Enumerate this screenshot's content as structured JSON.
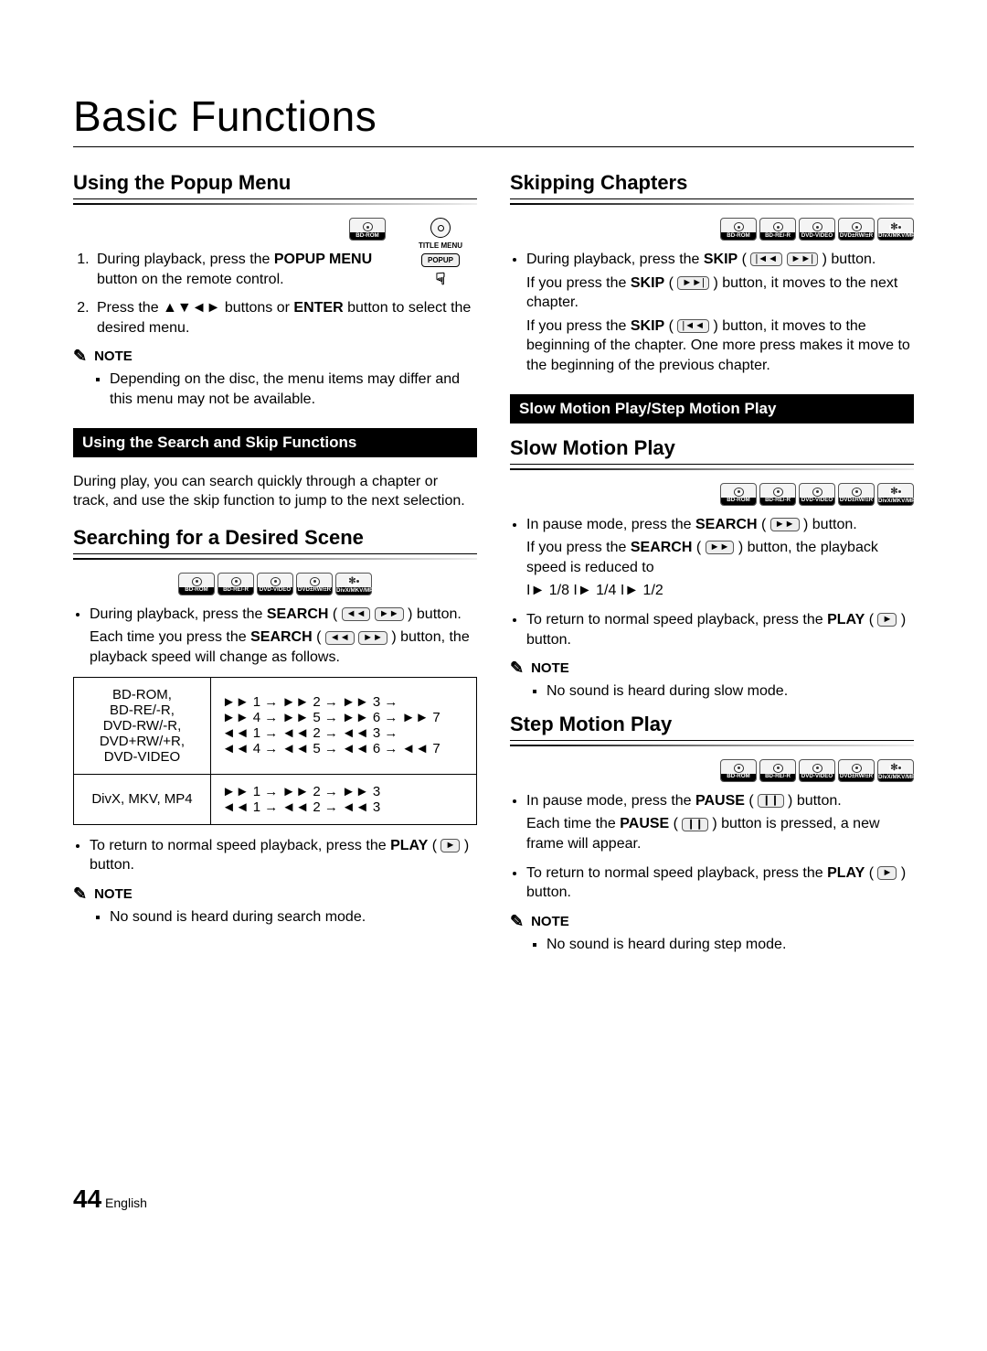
{
  "page_title": "Basic Functions",
  "left": {
    "h_popup": "Using the Popup Menu",
    "remote": {
      "top_label": "TITLE MENU",
      "btn_label": "POPUP"
    },
    "step1_a": "During playback, press the ",
    "step1_b": "POPUP MENU",
    "step1_c": " button on the remote control.",
    "step2_a": "Press the ▲▼◄► buttons or ",
    "step2_b": "ENTER",
    "step2_c": " button to select the desired menu.",
    "note_label": "NOTE",
    "note1": "Depending on the disc, the menu items may differ and this menu may not be available.",
    "bar1": "Using the Search and Skip Functions",
    "bar1_desc": "During play, you can search quickly through a chapter or track, and use the skip function to jump to the next selection.",
    "h_search": "Searching for a Desired Scene",
    "media": [
      "BD-ROM",
      "BD-RE/-R",
      "DVD-VIDEO",
      "DVD±RW/±R",
      "DivX/MKV/MP4"
    ],
    "search_bullet_a": "During playback, press the ",
    "search_bullet_b": "SEARCH",
    "search_bullet_c": " button.",
    "search_sub_a": "Each time you press the ",
    "search_sub_b": "SEARCH",
    "search_sub_c": " button, the playback speed will change as follows.",
    "table_r1_c1": "BD-ROM,\nBD-RE/-R,\nDVD-RW/-R,\nDVD+RW/+R,\nDVD-VIDEO",
    "table_r1_c2_l1": "►► 1 → ►► 2 → ►► 3 →",
    "table_r1_c2_l2": "►► 4 → ►► 5 → ►► 6 → ►► 7",
    "table_r1_c2_l3": "◄◄ 1 → ◄◄ 2 → ◄◄ 3 →",
    "table_r1_c2_l4": "◄◄ 4 → ◄◄ 5 → ◄◄ 6 → ◄◄ 7",
    "table_r2_c1": "DivX, MKV, MP4",
    "table_r2_c2_l1": "►► 1 → ►► 2 → ►► 3",
    "table_r2_c2_l2": "◄◄ 1 → ◄◄ 2 → ◄◄ 3",
    "return_a": "To return to normal speed playback, press the ",
    "return_b": "PLAY",
    "return_c": " button.",
    "note2": "No sound is heard during search mode."
  },
  "right": {
    "h_skip": "Skipping Chapters",
    "media": [
      "BD-ROM",
      "BD-RE/-R",
      "DVD-VIDEO",
      "DVD±RW/±R",
      "DivX/MKV/MP4"
    ],
    "skip_a": "During playback, press the ",
    "skip_b": "SKIP",
    "skip_c": " button.",
    "skip2_a": "If you press the ",
    "skip2_b": "SKIP",
    "skip2_c": " button, it moves to the next chapter.",
    "skip3_a": "If you press the ",
    "skip3_b": "SKIP",
    "skip3_c": " button, it moves to the beginning of the chapter. One more press makes it move to the beginning of the previous chapter.",
    "bar2": "Slow Motion Play/Step Motion Play",
    "h_slow": "Slow Motion Play",
    "slow_a": "In pause mode, press the ",
    "slow_b": "SEARCH",
    "slow_c": " button.",
    "slow2_a": "If you press the ",
    "slow2_b": "SEARCH",
    "slow2_c": " button, the playback speed is reduced to",
    "slow_speeds": "I► 1/8  I► 1/4  I► 1/2",
    "slow_ret_a": "To return to normal speed playback, press the ",
    "slow_ret_b": "PLAY",
    "slow_ret_c": " button.",
    "note_slow": "No sound is heard during slow mode.",
    "h_step": "Step Motion Play",
    "step_a": "In pause mode, press the ",
    "step_b": "PAUSE",
    "step_c": " button.",
    "step2_a": "Each time the ",
    "step2_b": "PAUSE",
    "step2_c": " button is pressed, a new frame will appear.",
    "step_ret_a": "To return to normal speed playback, press the ",
    "step_ret_b": "PLAY",
    "step_ret_c": " button.",
    "note_step": "No sound is heard during step mode."
  },
  "footer": {
    "page_num": "44",
    "lang": "English"
  },
  "icons": {
    "rewind": "◄◄",
    "forward": "►►",
    "skip_back": "|◄◄",
    "skip_fwd": "►►|",
    "play": "►",
    "pause": "❙❙"
  }
}
